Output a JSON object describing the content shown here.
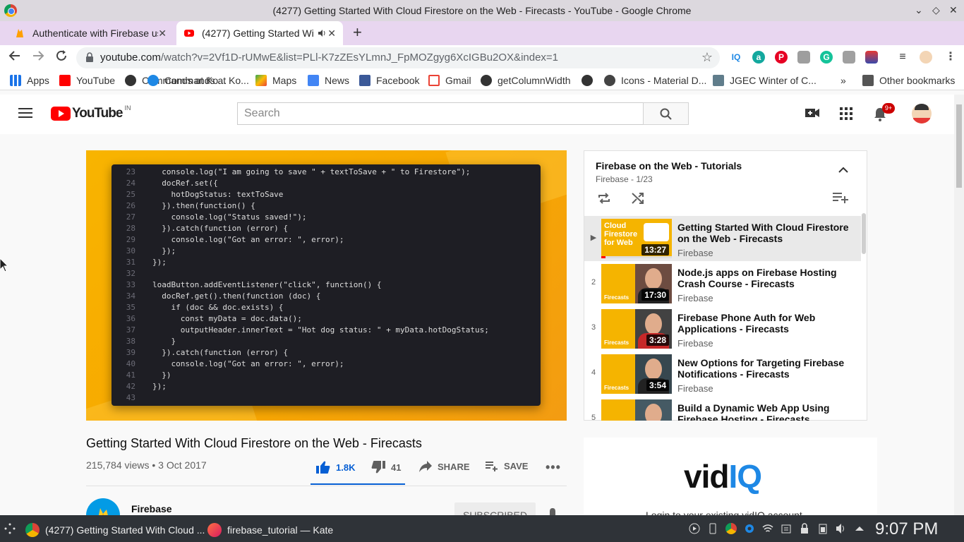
{
  "window": {
    "title": "(4277) Getting Started With Cloud Firestore on the Web - Firecasts - YouTube - Google Chrome"
  },
  "tabs": [
    {
      "label": "Authenticate with Firebase us",
      "close": "✕"
    },
    {
      "label": "(4277) Getting Started Wi",
      "close": "✕"
    }
  ],
  "toolbar": {
    "url_host": "youtube.com",
    "url_path": "/watch?v=2Vf1D-rUMwE&list=PLl-K7zZEsYLmnJ_FpMOZgyg6XcIGBu2OX&index=1",
    "ext_badge": "6"
  },
  "bookmarks": [
    {
      "label": "Apps"
    },
    {
      "label": "YouTube"
    },
    {
      "label": "Commands at Ko..."
    },
    {
      "label": "Maps"
    },
    {
      "label": "News"
    },
    {
      "label": "Facebook"
    },
    {
      "label": "Gmail"
    },
    {
      "label": "getColumnWidth"
    },
    {
      "label": "Icons - Material D..."
    },
    {
      "label": "JGEC Winter of C..."
    },
    {
      "label": "»"
    },
    {
      "label": "Other bookmarks"
    }
  ],
  "masthead": {
    "logo_word": "YouTube",
    "logo_country": "IN",
    "search_placeholder": "Search",
    "notifications": "9+"
  },
  "player": {
    "code_lines": [
      {
        "n": "23",
        "t": "  console.log(\"I am going to save \" + textToSave + \" to Firestore\");"
      },
      {
        "n": "24",
        "t": "  docRef.set({"
      },
      {
        "n": "25",
        "t": "    hotDogStatus: textToSave"
      },
      {
        "n": "26",
        "t": "  }).then(function() {"
      },
      {
        "n": "27",
        "t": "    console.log(\"Status saved!\");"
      },
      {
        "n": "28",
        "t": "  }).catch(function (error) {"
      },
      {
        "n": "29",
        "t": "    console.log(\"Got an error: \", error);"
      },
      {
        "n": "30",
        "t": "  });"
      },
      {
        "n": "31",
        "t": "});"
      },
      {
        "n": "32",
        "t": ""
      },
      {
        "n": "33",
        "t": "loadButton.addEventListener(\"click\", function() {"
      },
      {
        "n": "34",
        "t": "  docRef.get().then(function (doc) {"
      },
      {
        "n": "35",
        "t": "    if (doc && doc.exists) {"
      },
      {
        "n": "36",
        "t": "      const myData = doc.data();"
      },
      {
        "n": "37",
        "t": "      outputHeader.innerText = \"Hot dog status: \" + myData.hotDogStatus;"
      },
      {
        "n": "38",
        "t": "    }"
      },
      {
        "n": "39",
        "t": "  }).catch(function (error) {"
      },
      {
        "n": "40",
        "t": "    console.log(\"Got an error: \", error);"
      },
      {
        "n": "41",
        "t": "  })"
      },
      {
        "n": "42",
        "t": "});"
      },
      {
        "n": "43",
        "t": ""
      }
    ]
  },
  "video": {
    "title": "Getting Started With Cloud Firestore on the Web - Firecasts",
    "meta": "215,784 views • 3 Oct 2017",
    "likes": "1.8K",
    "dislikes": "41",
    "share": "SHARE",
    "save": "SAVE",
    "channel": "Firebase",
    "subscribe": "SUBSCRIBED"
  },
  "playlist": {
    "title": "Firebase on the Web - Tutorials",
    "subtitle": "Firebase - 1/23",
    "items": [
      {
        "index": "▶",
        "title": "Getting Started With Cloud Firestore on the Web - Firecasts",
        "channel": "Firebase",
        "duration": "13:27",
        "thumb_text": "Cloud Firestore for Web"
      },
      {
        "index": "2",
        "title": "Node.js apps on Firebase Hosting Crash Course - Firecasts",
        "channel": "Firebase",
        "duration": "17:30",
        "thumb_text": "Firecasts"
      },
      {
        "index": "3",
        "title": "Firebase Phone Auth for Web Applications - Firecasts",
        "channel": "Firebase",
        "duration": "3:28",
        "thumb_text": "Firecasts"
      },
      {
        "index": "4",
        "title": "New Options for Targeting Firebase Notifications - Firecasts",
        "channel": "Firebase",
        "duration": "3:54",
        "thumb_text": "Firecasts"
      },
      {
        "index": "5",
        "title": "Build a Dynamic Web App Using Firebase Hosting - Firecasts",
        "channel": "Firebase",
        "duration": "",
        "thumb_text": ""
      }
    ]
  },
  "vidiq": {
    "logo_a": "vid",
    "logo_b": "IQ",
    "login_text": "Login to your existing vidIQ account"
  },
  "taskbar": {
    "items": [
      {
        "label": "(4277) Getting Started With Cloud ..."
      },
      {
        "label": "firebase_tutorial  — Kate"
      }
    ],
    "clock": "9:07 PM"
  },
  "colors": {
    "accent": "#065fd4",
    "yt_red": "#ff0000",
    "firebase_yellow": "#f5b400"
  }
}
